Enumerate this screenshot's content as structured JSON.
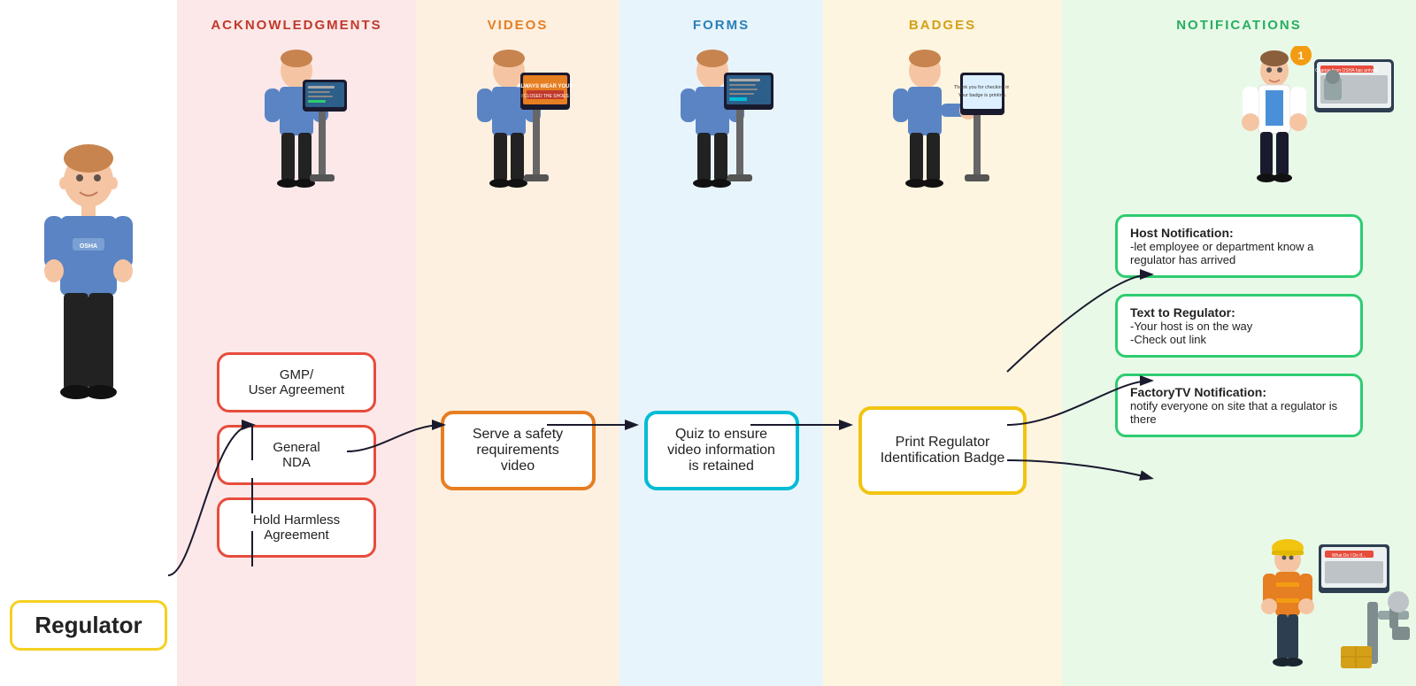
{
  "sections": {
    "regulator": {
      "label": "Regulator"
    },
    "acknowledgments": {
      "title": "ACKNOWLEDGMENTS",
      "cards": [
        {
          "id": "gmp",
          "text": "GMP/\nUser Agreement"
        },
        {
          "id": "nda",
          "text": "General\nNDA"
        },
        {
          "id": "harmless",
          "text": "Hold Harmless\nAgreement"
        }
      ]
    },
    "videos": {
      "title": "VIDEOS",
      "card": "Serve a safety requirements video"
    },
    "forms": {
      "title": "FORMS",
      "card": "Quiz to ensure video information is retained"
    },
    "badges": {
      "title": "BADGES",
      "card": "Print Regulator Identification Badge"
    },
    "notifications": {
      "title": "NOTIFICATIONS",
      "cards": [
        {
          "id": "host",
          "title": "Host Notification:",
          "body": "-let employee or department know a regulator has arrived"
        },
        {
          "id": "text",
          "title": "Text to Regulator:",
          "body": "-Your host is on the way\n-Check out link"
        },
        {
          "id": "factory",
          "title": "FactoryTV Notification:",
          "body": "notify everyone on site that a regulator is there"
        }
      ]
    }
  }
}
